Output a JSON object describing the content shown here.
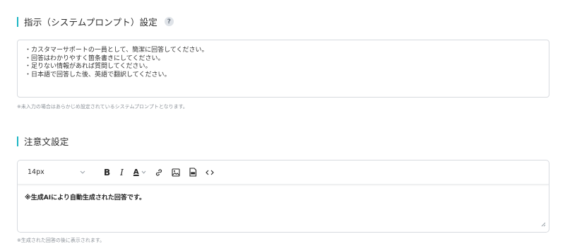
{
  "system_prompt_section": {
    "title": "指示（システムプロンプト）設定",
    "help_icon": "?",
    "lines": [
      "・カスタマーサポートの一員として、簡潔に回答してください。",
      "・回答はわかりやすく箇条書きにしてください。",
      "・足りない情報があれば質問してください。",
      "・日本語で回答した後、英語で翻訳してください。"
    ],
    "hint": "※未入力の場合はあらかじめ設定されているシステムプロンプトとなります。"
  },
  "notice_section": {
    "title": "注意文設定",
    "toolbar": {
      "font_size": "14px",
      "bold": "B",
      "italic": "I",
      "color": "A"
    },
    "content": "※生成AIにより自動生成された回答です。",
    "hint": "※生成された回答の後に表示されます。"
  },
  "icons": [
    "help-icon",
    "chevron-down-icon",
    "bold-icon",
    "italic-icon",
    "text-color-icon",
    "link-icon",
    "image-icon",
    "pdf-icon",
    "code-icon",
    "resize-handle-icon"
  ],
  "colors": {
    "accent": "#1bb5c4"
  }
}
